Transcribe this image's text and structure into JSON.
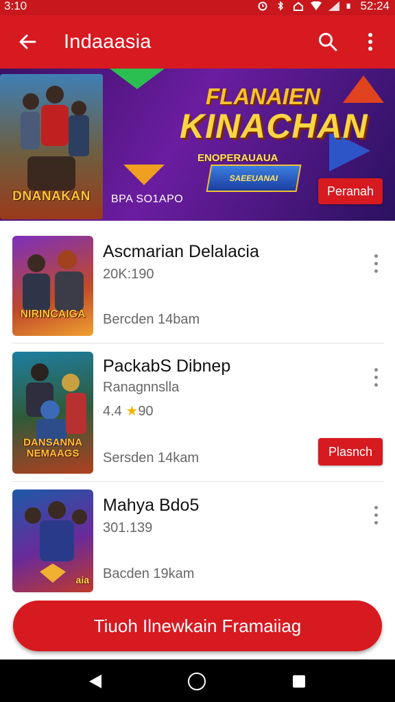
{
  "status_bar": {
    "time_left": "3:10",
    "time_right": "52:24"
  },
  "app_bar": {
    "title": "Indaaasia"
  },
  "banner": {
    "poster_title": "DNANAKAN",
    "title_line1": "FLANAIEN",
    "title_line2": "KINACHAN",
    "title_line3": "ENOPERAUAUA",
    "emblem_text": "SAEEUANAI",
    "caption": "BPA SO1APO",
    "button_label": "Peranah"
  },
  "items": [
    {
      "title": "Ascmarian Delalacia",
      "subtitle": "20K:190",
      "meta": "Bercden  14bam",
      "thumb_label": "NIRINCAIGA"
    },
    {
      "title": "PackabS Dibnep",
      "subtitle": "Ranagnnslla",
      "rating_num": "4.4",
      "rating_star": "★",
      "rating_count": "90",
      "meta": "Sersden  14kam",
      "button_label": "Plasnch",
      "thumb_label": "DANSANNA NEMAAGS"
    },
    {
      "title": "Mahya Bdo5",
      "subtitle": "301.139",
      "meta": "Bacden  19kam",
      "thumb_label": "aia"
    }
  ],
  "cta": {
    "label": "Tiuoh Ilnewkain Framaiiag"
  },
  "colors": {
    "brand_red": "#d71920",
    "status_red": "#c8171d",
    "banner_purple": "#6b1da0",
    "star": "#f0b400"
  }
}
